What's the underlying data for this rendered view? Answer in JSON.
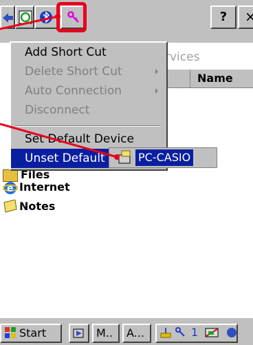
{
  "toolbar": {
    "help_label": "?",
    "close_label": "×"
  },
  "window": {
    "services_tab": "rvices",
    "column_name": "Name"
  },
  "menu": {
    "items": [
      {
        "label": "Add Short Cut",
        "enabled": true
      },
      {
        "label": "Delete Short Cut",
        "enabled": false
      },
      {
        "label": "Auto Connection",
        "enabled": false
      },
      {
        "label": "Disconnect",
        "enabled": false
      },
      {
        "label": "Set Default Device",
        "enabled": true
      },
      {
        "label": "Unset Default",
        "enabled": true,
        "selected": true
      }
    ]
  },
  "submenu": {
    "label": "PC-CASIO"
  },
  "list": {
    "items": [
      {
        "label": "Files"
      },
      {
        "label": "Internet"
      },
      {
        "label": "Notes"
      }
    ]
  },
  "taskbar": {
    "start_label": "Start",
    "btn_m": "M..",
    "btn_a": "A...",
    "clock_digit": "1"
  },
  "colors": {
    "accent_red": "#e8001c",
    "selection": "#0a1fa0",
    "chrome": "#c0c0c0"
  }
}
